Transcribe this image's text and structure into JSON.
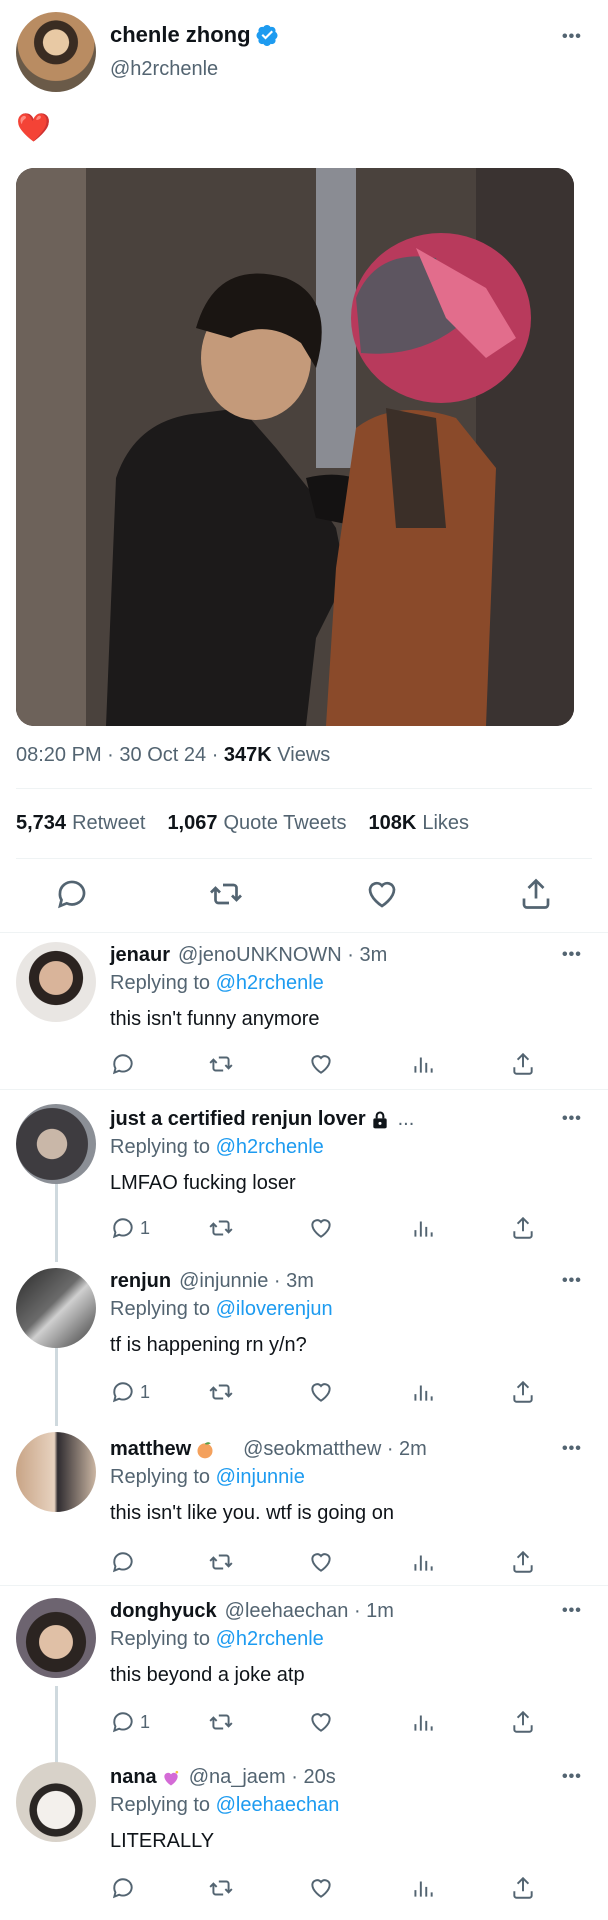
{
  "main_tweet": {
    "author_name": "chenle zhong",
    "author_handle": "@h2rchenle",
    "text": "❤️",
    "time": "08:20 PM",
    "date": "30 Oct 24",
    "views_count": "347K",
    "views_label": "Views",
    "meta_sep": "·",
    "stats": [
      {
        "count": "5,734",
        "label": "Retweet"
      },
      {
        "count": "1,067",
        "label": "Quote Tweets"
      },
      {
        "count": "108K",
        "label": "Likes"
      }
    ],
    "icons": [
      "reply-icon",
      "retweet-icon",
      "like-icon",
      "share-icon"
    ]
  },
  "replies": [
    {
      "name": "jenaur",
      "handle": "@jenoUNKNOWN · 3m",
      "replying_label": "Replying to",
      "replying_to": "@h2rchenle",
      "text": "this isn't funny anymore",
      "reply_count": ""
    },
    {
      "name": "just a certified renjun lover",
      "handle": "...",
      "replying_label": "Replying to",
      "replying_to": "@h2rchenle",
      "text": "LMFAO fucking loser",
      "reply_count": "1"
    },
    {
      "name": "renjun",
      "handle": "@injunnie · 3m",
      "replying_label": "Replying to",
      "replying_to": "@iloverenjun",
      "text": "tf is happening rn y/n?",
      "reply_count": "1"
    },
    {
      "name": "matthew",
      "handle": "@seokmatthew · 2m",
      "replying_label": "Replying to",
      "replying_to": "@injunnie",
      "text": "this isn't like you. wtf is going on",
      "reply_count": ""
    },
    {
      "name": "donghyuck",
      "handle": "@leehaechan · 1m",
      "replying_label": "Replying to",
      "replying_to": "@h2rchenle",
      "text": "this beyond a joke atp",
      "reply_count": "1"
    },
    {
      "name": "nana",
      "handle": "@na_jaem · 20s",
      "replying_label": "Replying to",
      "replying_to": "@leehaechan",
      "text": "LITERALLY",
      "reply_count": ""
    }
  ],
  "colors": {
    "accent": "#1d9bf0",
    "text": "#0f1419",
    "muted": "#536471",
    "heart": "#e0245e"
  }
}
